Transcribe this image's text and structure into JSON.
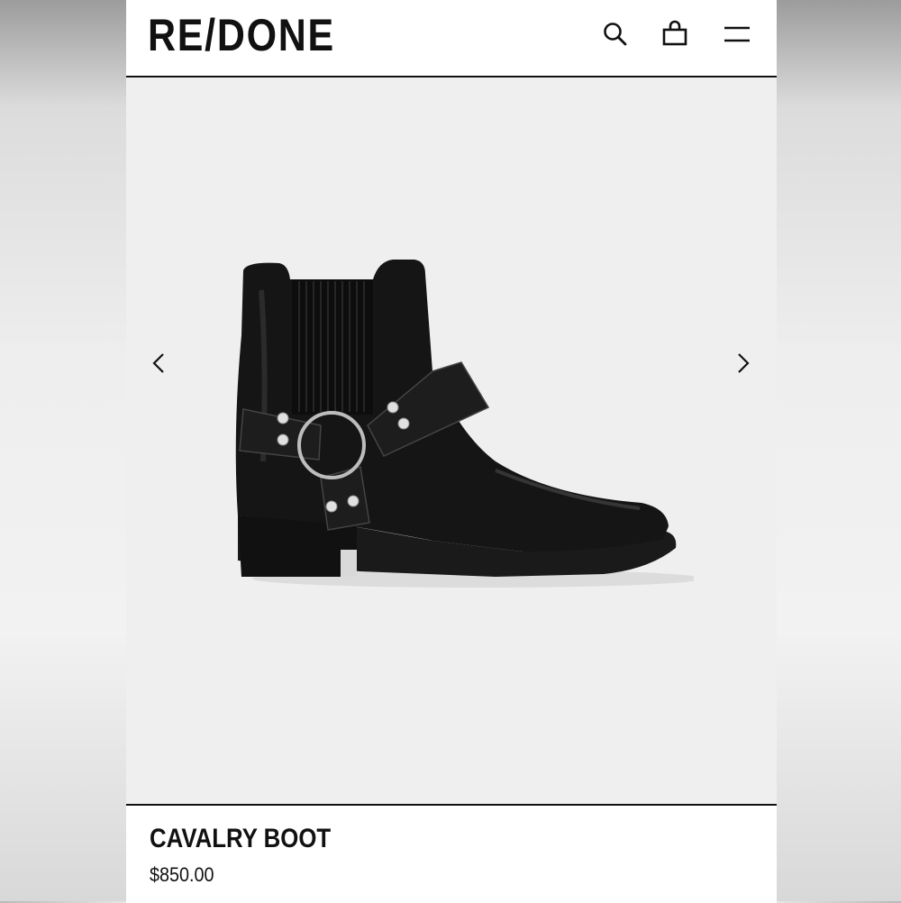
{
  "header": {
    "logo": "RE/DONE",
    "icons": [
      "search-icon",
      "shopping-bag-icon",
      "hamburger-menu-icon"
    ]
  },
  "gallery": {
    "prev_icon": "chevron-left-icon",
    "next_icon": "chevron-right-icon",
    "image": "black leather harness ankle boot"
  },
  "product": {
    "name": "CAVALRY BOOT",
    "price": "$850.00"
  },
  "colors": {
    "background": "#ffffff",
    "gallery_bg": "#efefef",
    "text": "#111111"
  }
}
